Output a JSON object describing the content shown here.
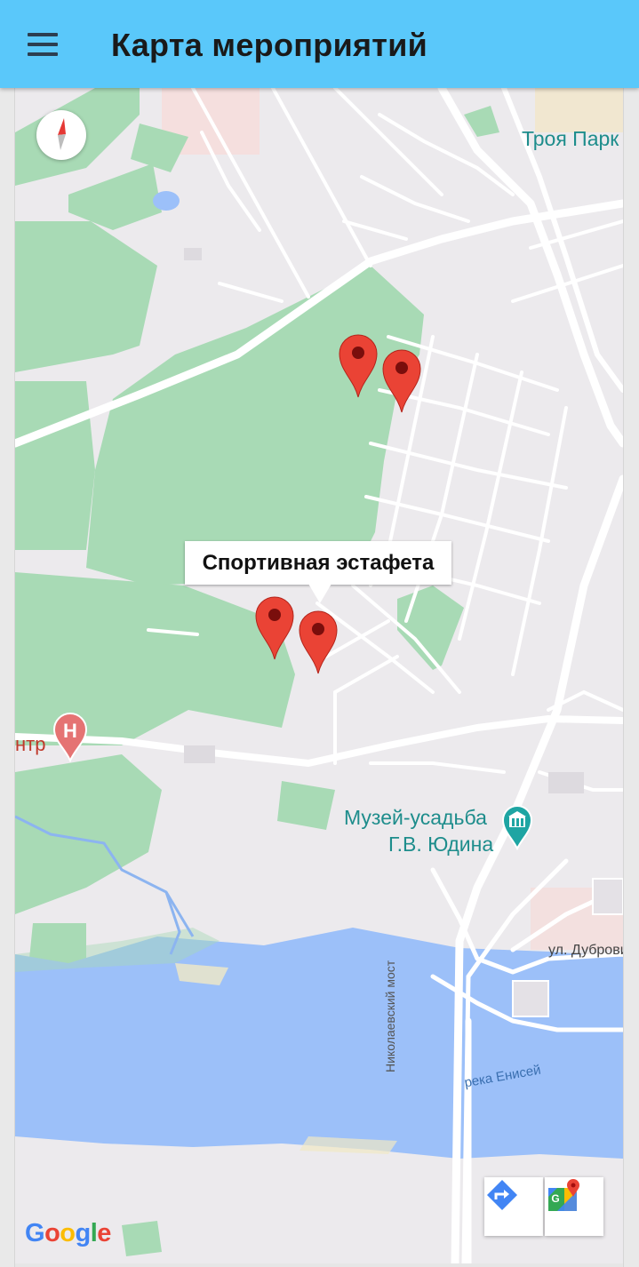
{
  "app_bar": {
    "title": "Карта мероприятий",
    "background_color": "#5ac8fa",
    "menu_icon": "hamburger-menu-icon"
  },
  "map": {
    "labels": {
      "troya_park": "Троя Парк",
      "hospital_partial": "нтр",
      "museum_line1": "Музей-усадьба",
      "museum_line2": "Г.В. Юдина",
      "street_dubrovin": "ул. Дубровин",
      "bridge": "Николаевский мост",
      "river": "река Енисей"
    },
    "info_window": {
      "text": "Спортивная эстафета"
    },
    "markers_count": 4,
    "compass_icon": "compass-icon",
    "toolbar": {
      "directions_icon": "directions-icon",
      "open_in_maps_icon": "google-maps-icon"
    },
    "attribution": [
      "G",
      "o",
      "o",
      "g",
      "l",
      "e"
    ],
    "colors": {
      "park": "#a8dab5",
      "water": "#9cc0f9",
      "road": "#ffffff",
      "marker": "#ea4335",
      "poi_teal": "#1e8d8c",
      "hospital": "#e57373"
    }
  }
}
